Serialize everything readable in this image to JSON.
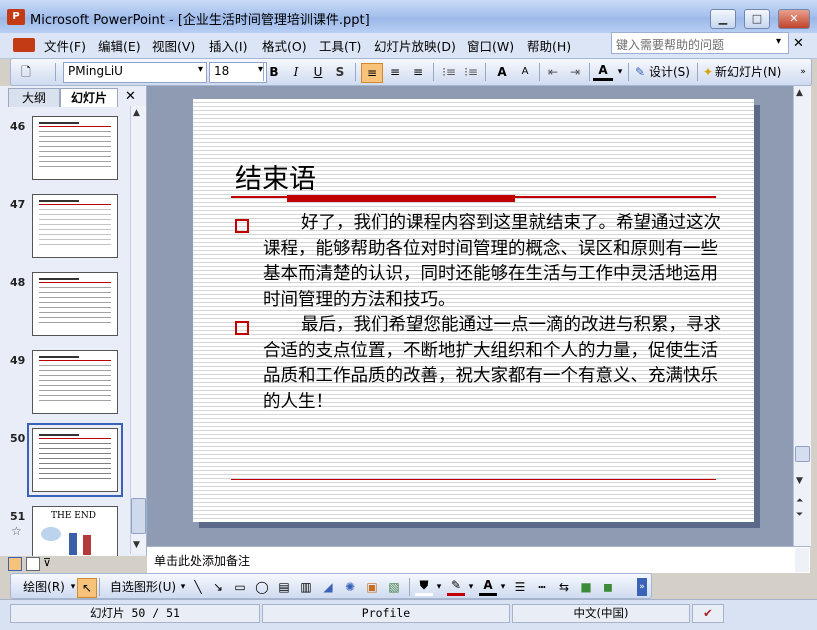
{
  "window": {
    "title": "Microsoft PowerPoint - [企业生活时间管理培训课件.ppt]",
    "app_icon": "powerpoint-icon",
    "min_glyph": "▁",
    "max_glyph": "□",
    "close_glyph": "✕"
  },
  "menu": {
    "items": [
      "文件(F)",
      "编辑(E)",
      "视图(V)",
      "插入(I)",
      "格式(O)",
      "工具(T)",
      "幻灯片放映(D)",
      "窗口(W)",
      "帮助(H)"
    ],
    "help_placeholder": "键入需要帮助的问题",
    "close_glyph": "✕",
    "arrow_glyph": "▾"
  },
  "format_toolbar": {
    "font": "PMingLiU",
    "font_size": "18",
    "bold": "B",
    "italic": "I",
    "underline": "U",
    "shadow": "S",
    "font_color_label": "A",
    "grow_font": "A",
    "shrink_font": "A",
    "design_label": "设计(S)",
    "new_slide_label": "新幻灯片(N)",
    "active_align": "left"
  },
  "left_pane": {
    "tabs": [
      "大纲",
      "幻灯片"
    ],
    "active_tab": "幻灯片",
    "close_glyph": "✕",
    "thumbnails": [
      {
        "number": "46",
        "caption": ""
      },
      {
        "number": "47",
        "caption": ""
      },
      {
        "number": "48",
        "caption": ""
      },
      {
        "number": "49",
        "caption": ""
      },
      {
        "number": "50",
        "caption": "",
        "selected": true
      },
      {
        "number": "51",
        "caption": "THE END",
        "star": "☆"
      }
    ]
  },
  "slide": {
    "title": "结束语",
    "paragraphs": [
      "好了，我们的课程内容到这里就结束了。希望通过这次课程，能够帮助各位对时间管理的概念、误区和原则有一些基本而清楚的认识，同时还能够在生活与工作中灵活地运用时间管理的方法和技巧。",
      "最后，我们希望您能通过一点一滴的改进与积累，寻求合适的支点位置，不断地扩大组织和个人的力量，促使生活品质和工作品质的改善，祝大家都有一个有意义、充满快乐的人生！"
    ],
    "accent_color": "#c00000"
  },
  "notes": {
    "placeholder": "单击此处添加备注"
  },
  "draw_toolbar": {
    "draw_label": "绘图(R)",
    "autoshapes_label": "自选图形(U)"
  },
  "status": {
    "slide": "幻灯片 50 / 51",
    "theme": "Profile",
    "language": "中文(中国)"
  }
}
